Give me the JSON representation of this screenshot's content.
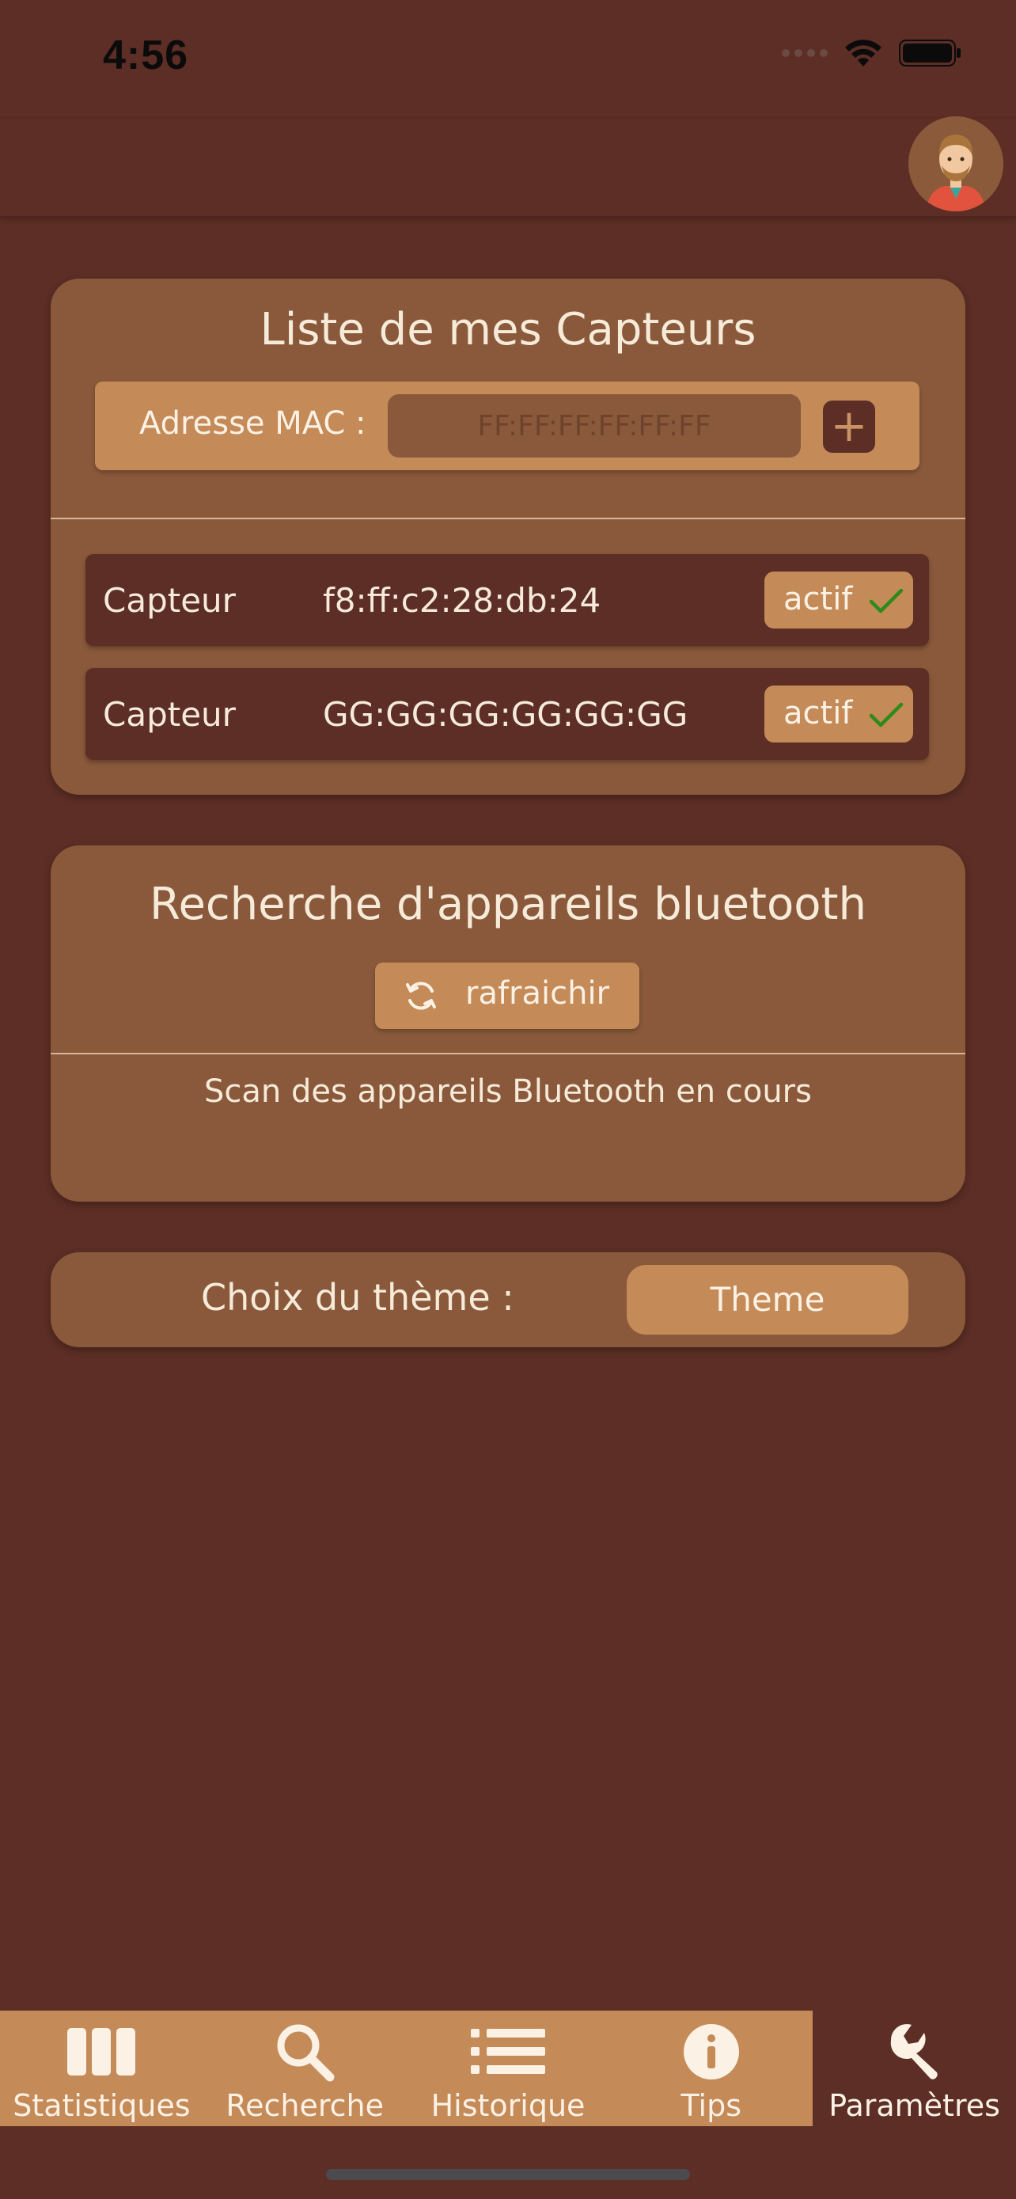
{
  "status_bar": {
    "time": "4:56"
  },
  "sensors_card": {
    "title": "Liste de mes Capteurs",
    "mac_label": "Adresse MAC :",
    "mac_placeholder": "FF:FF:FF:FF:FF:FF",
    "add_label": "+",
    "items": [
      {
        "label": "Capteur",
        "mac": "f8:ff:c2:28:db:24",
        "status": "actif"
      },
      {
        "label": "Capteur",
        "mac": "GG:GG:GG:GG:GG:GG",
        "status": "actif"
      }
    ]
  },
  "bluetooth_card": {
    "title": "Recherche d'appareils bluetooth",
    "refresh_label": "rafraichir",
    "scan_status": "Scan des appareils Bluetooth en cours"
  },
  "theme_card": {
    "label": "Choix du thème :",
    "button_label": "Theme"
  },
  "tab_bar": {
    "tabs": [
      {
        "label": "Statistiques",
        "icon": "columns-icon"
      },
      {
        "label": "Recherche",
        "icon": "search-icon"
      },
      {
        "label": "Historique",
        "icon": "list-icon"
      },
      {
        "label": "Tips",
        "icon": "info-icon"
      },
      {
        "label": "Paramètres",
        "icon": "wrench-icon"
      }
    ],
    "active_tab": "Paramètres"
  },
  "colors": {
    "background": "#5c2e25",
    "card": "#8a593b",
    "accent": "#c48a58",
    "text": "#f6ead9",
    "check": "#2f8a1c"
  }
}
